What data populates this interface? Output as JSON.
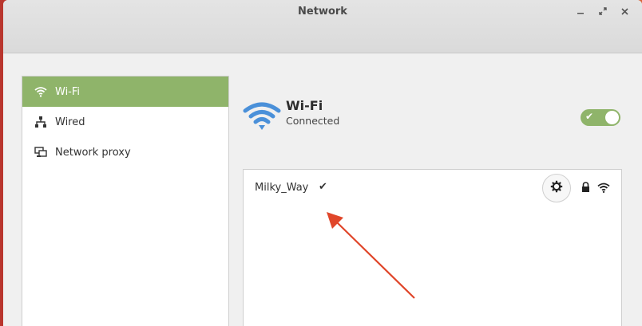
{
  "window": {
    "title": "Network",
    "controls": [
      "minimize-icon",
      "restore-icon",
      "close-icon"
    ]
  },
  "sidebar": {
    "items": [
      {
        "label": "Wi-Fi",
        "icon": "wifi-icon",
        "active": true
      },
      {
        "label": "Wired",
        "icon": "wired-icon",
        "active": false
      },
      {
        "label": "Network proxy",
        "icon": "proxy-icon",
        "active": false
      }
    ]
  },
  "wifi": {
    "title": "Wi-Fi",
    "status": "Connected",
    "enabled": true
  },
  "networks": [
    {
      "name": "Milky_Way",
      "connected": true,
      "secured": true
    }
  ],
  "colors": {
    "accent": "#8fb46a",
    "wifi_blue": "#4a90d9",
    "annotation_arrow": "#e0462a"
  }
}
